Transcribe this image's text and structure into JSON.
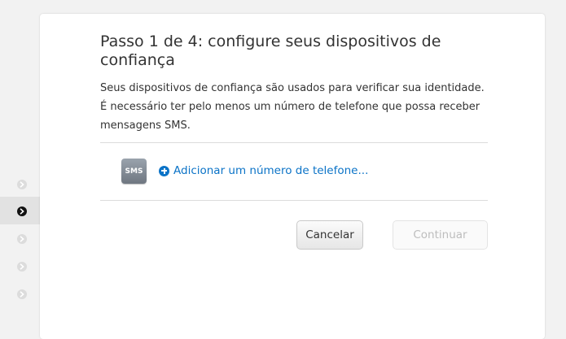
{
  "steps": {
    "items": [
      {
        "state": "inactive"
      },
      {
        "state": "active"
      },
      {
        "state": "inactive"
      },
      {
        "state": "inactive"
      },
      {
        "state": "inactive"
      }
    ],
    "current": 2
  },
  "dialog": {
    "title": "Passo 1 de 4: configure seus dispositivos de confiança",
    "description": "Seus dispositivos de confiança são usados para verificar sua identidade. É necessário ter pelo menos um número de telefone que possa receber mensagens SMS.",
    "sms_icon_label": "SMS",
    "add_phone_link": "Adicionar um número de telefone...",
    "cancel_label": "Cancelar",
    "continue_label": "Continuar"
  },
  "colors": {
    "link": "#0b73c7",
    "background": "#f2f2f2",
    "disabled_text": "#bdbdbd"
  },
  "icons": [
    "chevron-right-icon",
    "sms-icon",
    "plus-circle-icon"
  ]
}
